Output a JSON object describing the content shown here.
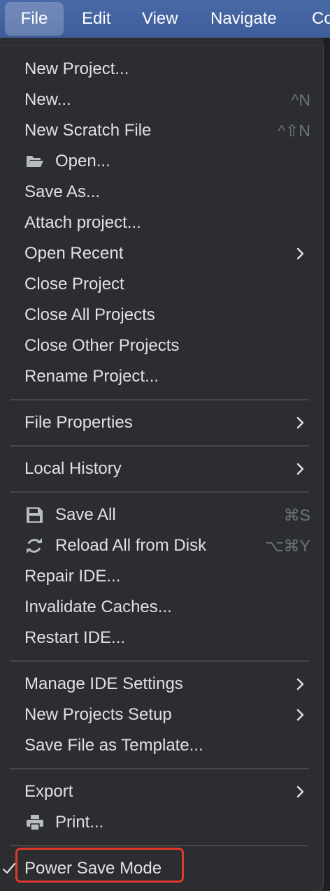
{
  "menubar": {
    "items": [
      {
        "label": "File",
        "active": true
      },
      {
        "label": "Edit"
      },
      {
        "label": "View"
      },
      {
        "label": "Navigate"
      },
      {
        "label": "Co"
      }
    ]
  },
  "file_menu": {
    "items": [
      {
        "label": "New Project..."
      },
      {
        "label": "New...",
        "shortcut": "^N"
      },
      {
        "label": "New Scratch File",
        "shortcut": "^⇧N"
      },
      {
        "label": "Open...",
        "icon": "folder-open-icon"
      },
      {
        "label": "Save As..."
      },
      {
        "label": "Attach project..."
      },
      {
        "label": "Open Recent",
        "submenu": true
      },
      {
        "label": "Close Project"
      },
      {
        "label": "Close All Projects"
      },
      {
        "label": "Close Other Projects"
      },
      {
        "label": "Rename Project..."
      },
      {
        "label": "File Properties",
        "submenu": true
      },
      {
        "label": "Local History",
        "submenu": true
      },
      {
        "label": "Save All",
        "shortcut": "⌘S",
        "icon": "floppy-disk-icon"
      },
      {
        "label": "Reload All from Disk",
        "shortcut": "⌥⌘Y",
        "icon": "reload-icon"
      },
      {
        "label": "Repair IDE..."
      },
      {
        "label": "Invalidate Caches..."
      },
      {
        "label": "Restart IDE..."
      },
      {
        "label": "Manage IDE Settings",
        "submenu": true
      },
      {
        "label": "New Projects Setup",
        "submenu": true
      },
      {
        "label": "Save File as Template..."
      },
      {
        "label": "Export",
        "submenu": true
      },
      {
        "label": "Print...",
        "icon": "printer-icon"
      },
      {
        "label": "Power Save Mode",
        "checked": true,
        "highlighted": true
      }
    ]
  },
  "colors": {
    "menubar_bg": "#3d5c99",
    "menu_bg": "#2b2d30",
    "text": "#dfe1e5",
    "shortcut_text": "#6f737a",
    "highlight_border": "#e0392c"
  }
}
